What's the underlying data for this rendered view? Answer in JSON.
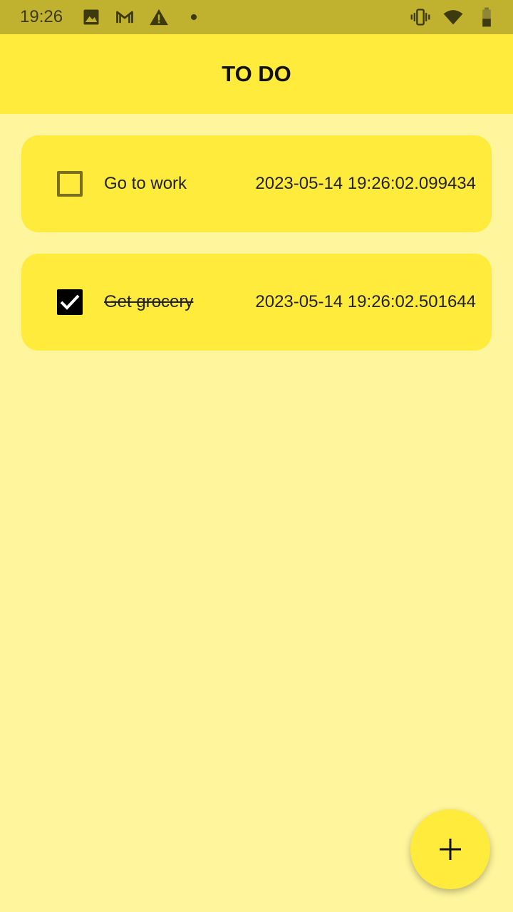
{
  "status_bar": {
    "time": "19:26",
    "icons": [
      "image-icon",
      "gmail-icon",
      "warning-icon",
      "dot-icon",
      "vibrate-icon",
      "wifi-icon",
      "battery-icon"
    ]
  },
  "app_bar": {
    "title": "TO DO"
  },
  "todos": [
    {
      "label": "Go to work",
      "timestamp": "2023-05-14 19:26:02.099434",
      "checked": false
    },
    {
      "label": "Get grocery",
      "timestamp": "2023-05-14 19:26:02.501644",
      "checked": true
    }
  ],
  "fab": {
    "icon": "plus-icon"
  },
  "colors": {
    "background": "#FFF59D",
    "app_bar": "#FFEB3B",
    "status_bar": "#C0B22E",
    "card": "#FFEB3B"
  }
}
